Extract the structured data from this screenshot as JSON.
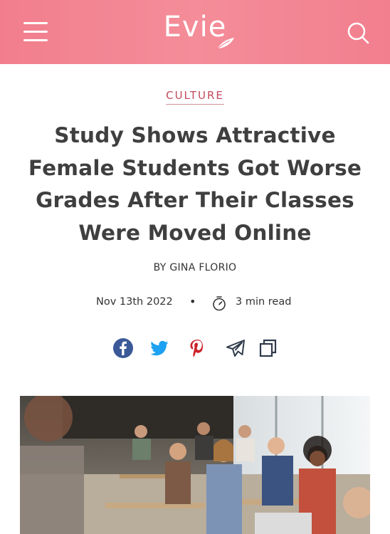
{
  "header": {
    "logo_text": "Evie",
    "menu_icon": "hamburger-menu-icon",
    "search_icon": "search-icon",
    "brand_color": "#f48494"
  },
  "article": {
    "category": "CULTURE",
    "title": "Study Shows Attractive Female Students Got Worse Grades After Their Classes Were Moved Online",
    "byline": "BY GINA FLORIO",
    "date": "Nov 13th 2022",
    "separator": "•",
    "read_time": "3 min read",
    "accent_color": "#c24a5c"
  },
  "share": {
    "icons": [
      "facebook-icon",
      "twitter-icon",
      "pinterest-icon",
      "telegram-icon",
      "copy-icon"
    ],
    "colors": {
      "facebook": "#3b5998",
      "twitter": "#1da1f2",
      "pinterest": "#cb2027",
      "telegram": "#2f3a4a",
      "copy": "#2f3a4a"
    }
  },
  "hero_image": {
    "subject": "classroom of students applauding"
  }
}
